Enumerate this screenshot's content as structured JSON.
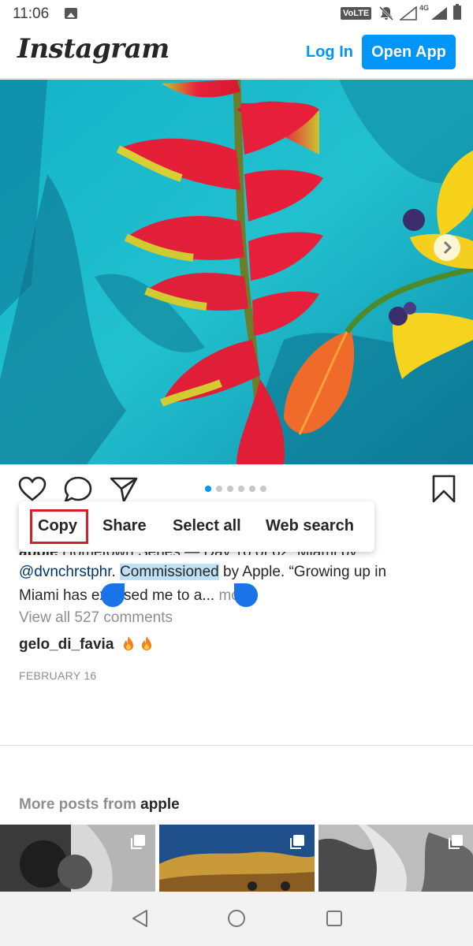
{
  "status_bar": {
    "time": "11:06",
    "volte": "VoLTE",
    "network": "4G"
  },
  "header": {
    "logo": "Instagram",
    "login_label": "Log In",
    "open_app_label": "Open App"
  },
  "carousel": {
    "dot_count": 6,
    "active_dot": 1
  },
  "context_menu": {
    "copy": "Copy",
    "share": "Share",
    "select_all": "Select all",
    "web_search": "Web search"
  },
  "caption": {
    "username": "apple",
    "line1_rest": " Hometown Series — Day 16 of 62. Miami by",
    "mention": "@dvnchrstphr",
    "period": ". ",
    "highlighted": "Commissioned",
    "line2_rest": " by Apple. “Growing up in",
    "line3": "Miami has exposed me to a...",
    "more": "more"
  },
  "view_all_comments": "View all 527 comments",
  "comment": {
    "username": "gelo_di_favia"
  },
  "post_date": "FEBRUARY 16",
  "more_posts": {
    "prefix": "More posts from ",
    "account": "apple"
  },
  "colors": {
    "accent": "#0095f6",
    "highlight": "#bfe1f6",
    "selection_handle": "#1a73e8",
    "copy_outline": "#d0202a"
  }
}
